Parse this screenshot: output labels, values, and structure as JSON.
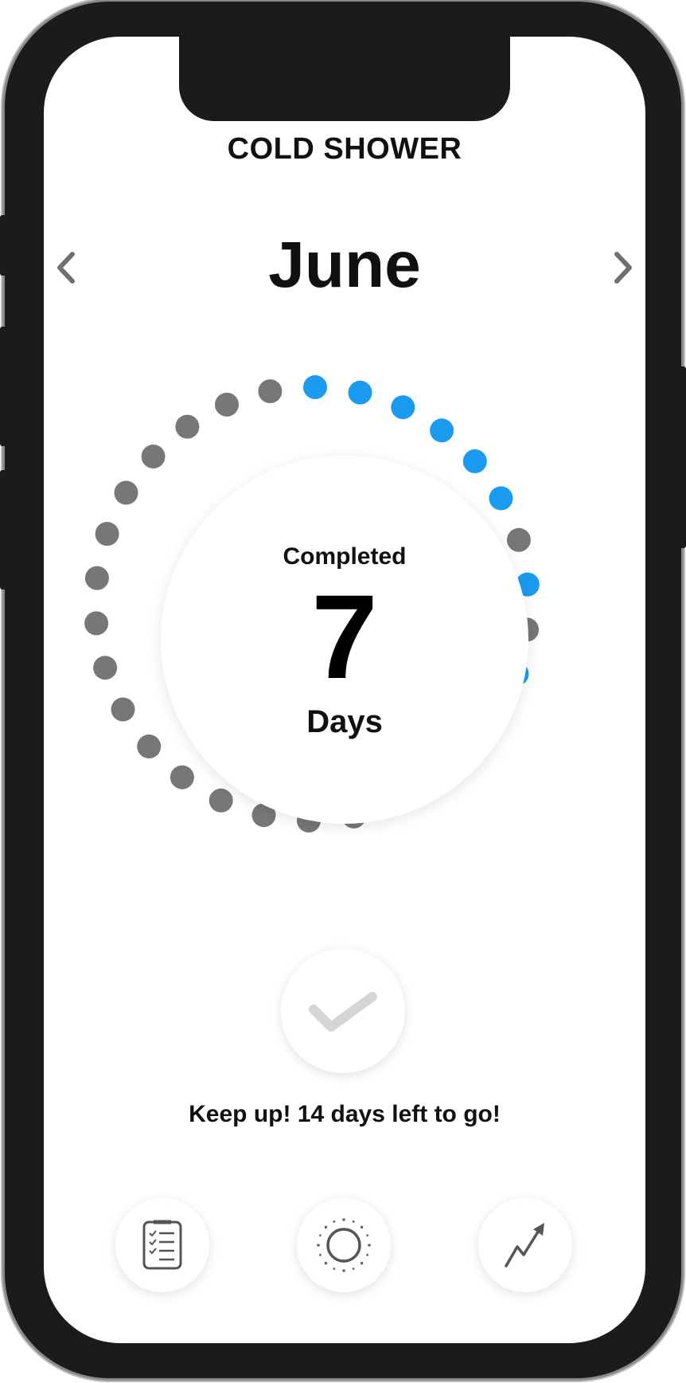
{
  "app": {
    "title": "COLD SHOWER"
  },
  "calendar": {
    "month": "June",
    "prev_icon": "chevron-left-icon",
    "next_icon": "chevron-right-icon"
  },
  "progress": {
    "completed_label": "Completed",
    "completed_count": "7",
    "days_label": "Days",
    "total_days": 30,
    "day_status": [
      "done",
      "done",
      "done",
      "done",
      "done",
      "done",
      "missed",
      "done",
      "missed",
      "done",
      "missed",
      "missed",
      "missed",
      "missed",
      "missed",
      "missed",
      "missed",
      "missed",
      "missed",
      "missed",
      "missed",
      "missed",
      "missed",
      "missed",
      "missed",
      "missed",
      "missed",
      "missed",
      "missed",
      "missed"
    ],
    "colors": {
      "done": "#1a9bf0",
      "missed": "#777777"
    }
  },
  "actions": {
    "check_icon": "checkmark-icon",
    "motivation": "Keep up! 14 days left to go!"
  },
  "tab_bar": {
    "items": [
      {
        "name": "checklist",
        "icon": "checklist-icon"
      },
      {
        "name": "today",
        "icon": "sun-icon"
      },
      {
        "name": "stats",
        "icon": "trend-chart-icon"
      }
    ]
  }
}
